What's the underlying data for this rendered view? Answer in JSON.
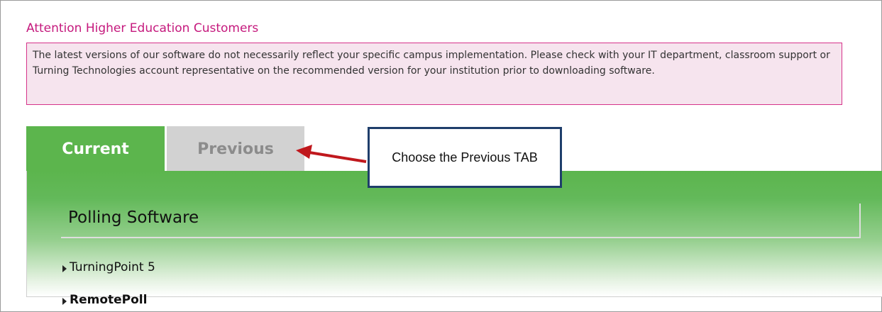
{
  "notice": {
    "title": "Attention Higher Education Customers",
    "body": "The latest versions of our software do not necessarily reflect your specific campus implementation. Please check with your IT department, classroom support or Turning Technologies account representative on the recommended version for your institution prior to downloading software."
  },
  "tabs": [
    {
      "label": "Current",
      "active": true
    },
    {
      "label": "Previous",
      "active": false
    }
  ],
  "section": {
    "title": "Polling Software",
    "items": [
      {
        "label": "TurningPoint 5"
      },
      {
        "label": "RemotePoll"
      }
    ]
  },
  "annotation": {
    "callout_text": "Choose the Previous TAB",
    "arrow_color": "#c0181d",
    "border_color": "#1f3e6b"
  },
  "colors": {
    "accent_pink": "#c5197d",
    "notice_bg": "#f6e4ee",
    "tab_active": "#5cb54d",
    "tab_inactive": "#d2d2d2"
  }
}
